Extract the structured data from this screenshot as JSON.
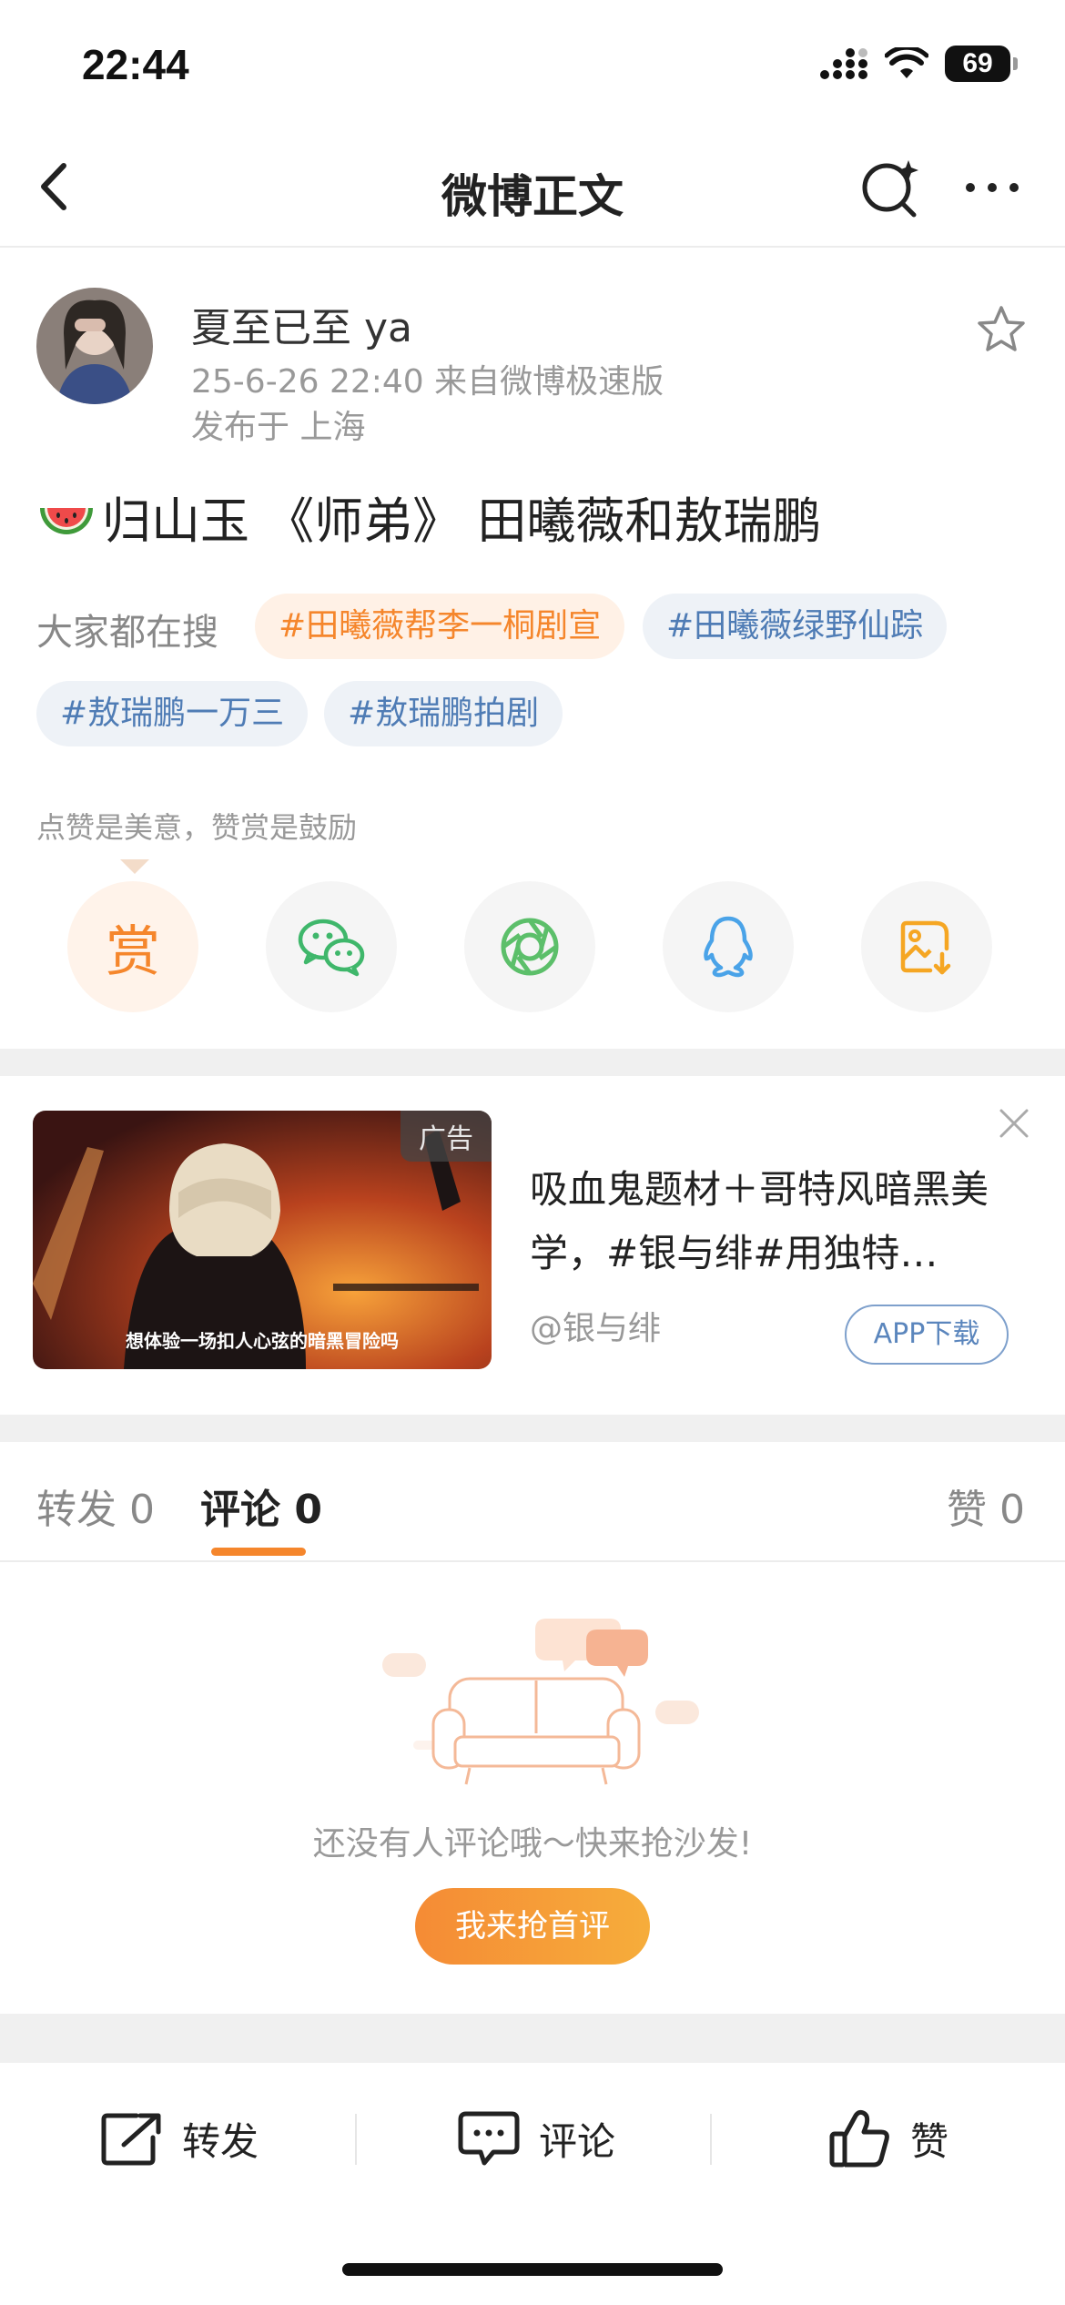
{
  "status_bar": {
    "time": "22:44",
    "battery": "69"
  },
  "nav": {
    "title": "微博正文"
  },
  "post": {
    "username": "夏至已至 ya",
    "meta": "25-6-26 22:40  来自微博极速版",
    "location": "发布于 上海",
    "text": "归山玉 《师弟》 田曦薇和敖瑞鹏"
  },
  "search": {
    "label": "大家都在搜",
    "tags": [
      "#田曦薇帮李一桐剧宣",
      "#田曦薇绿野仙踪",
      "#敖瑞鹏一万三",
      "#敖瑞鹏拍剧"
    ]
  },
  "reward": {
    "hint": "点赞是美意，赞赏是鼓励",
    "button": "赏"
  },
  "ad": {
    "badge": "广告",
    "image_caption": "想体验一场扣人心弦的暗黑冒险吗",
    "title": "吸血鬼题材＋哥特风暗黑美学，#银与绯#用独特…",
    "source": "@银与绯",
    "download": "APP下载"
  },
  "tabs": {
    "repost": "转发 0",
    "comment": "评论 0",
    "like": "赞 0"
  },
  "empty": {
    "text": "还没有人评论哦～快来抢沙发!",
    "button": "我来抢首评"
  },
  "bottom": {
    "repost": "转发",
    "comment": "评论",
    "like": "赞"
  },
  "colors": {
    "accent": "#f5862c",
    "tag_blue": "#4f7cb5",
    "wechat": "#3fb76b",
    "moments": "#5cbf6a",
    "qq": "#4aa3e8"
  }
}
